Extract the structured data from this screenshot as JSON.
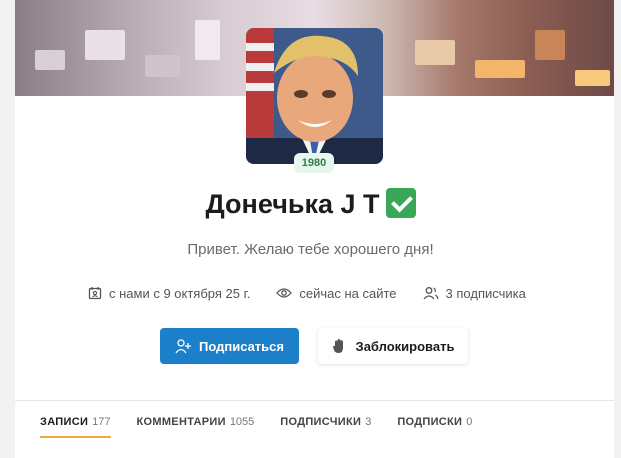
{
  "profile": {
    "year": "1980",
    "name": "Донечька J T",
    "verified_icon": "check-mark-button",
    "status": "Привет. Желаю тебе хорошего дня!",
    "meta": {
      "joined": "с нами с 9 октября 25 г.",
      "online": "сейчас на сайте",
      "subscribers": "3 подписчика"
    }
  },
  "actions": {
    "subscribe_label": "Подписаться",
    "block_label": "Заблокировать"
  },
  "tabs": [
    {
      "label": "ЗАПИСИ",
      "count": "177",
      "active": true
    },
    {
      "label": "КОММЕНТАРИИ",
      "count": "1055",
      "active": false
    },
    {
      "label": "ПОДПИСЧИКИ",
      "count": "3",
      "active": false
    },
    {
      "label": "ПОДПИСКИ",
      "count": "0",
      "active": false
    }
  ],
  "colors": {
    "accent": "#1b7fc9",
    "tab_underline": "#f0a940",
    "verified": "#3aa757",
    "year_badge_bg": "#e7f6ec"
  }
}
